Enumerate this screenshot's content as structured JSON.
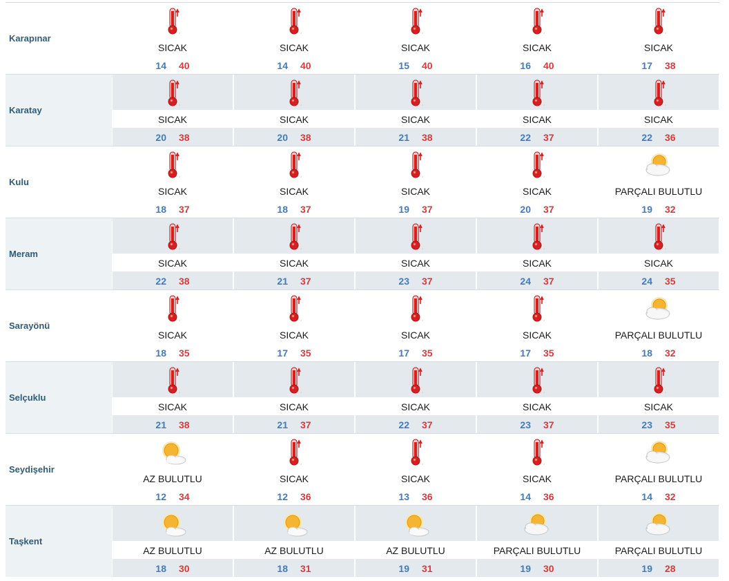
{
  "colors": {
    "low": "#3f7cc0",
    "high": "#d93b3b",
    "alt_band": "#e3e9ed",
    "name_text": "#2f5c7a"
  },
  "rows": [
    {
      "district": "Karapınar",
      "days": [
        {
          "icon": "thermometer-icon",
          "condition": "SICAK",
          "low": "14",
          "high": "40"
        },
        {
          "icon": "thermometer-icon",
          "condition": "SICAK",
          "low": "14",
          "high": "40"
        },
        {
          "icon": "thermometer-icon",
          "condition": "SICAK",
          "low": "15",
          "high": "40"
        },
        {
          "icon": "thermometer-icon",
          "condition": "SICAK",
          "low": "16",
          "high": "40"
        },
        {
          "icon": "thermometer-icon",
          "condition": "SICAK",
          "low": "17",
          "high": "38"
        }
      ]
    },
    {
      "district": "Karatay",
      "days": [
        {
          "icon": "thermometer-icon",
          "condition": "SICAK",
          "low": "20",
          "high": "38"
        },
        {
          "icon": "thermometer-icon",
          "condition": "SICAK",
          "low": "20",
          "high": "38"
        },
        {
          "icon": "thermometer-icon",
          "condition": "SICAK",
          "low": "21",
          "high": "38"
        },
        {
          "icon": "thermometer-icon",
          "condition": "SICAK",
          "low": "22",
          "high": "37"
        },
        {
          "icon": "thermometer-icon",
          "condition": "SICAK",
          "low": "22",
          "high": "36"
        }
      ]
    },
    {
      "district": "Kulu",
      "days": [
        {
          "icon": "thermometer-icon",
          "condition": "SICAK",
          "low": "18",
          "high": "37"
        },
        {
          "icon": "thermometer-icon",
          "condition": "SICAK",
          "low": "18",
          "high": "37"
        },
        {
          "icon": "thermometer-icon",
          "condition": "SICAK",
          "low": "19",
          "high": "37"
        },
        {
          "icon": "thermometer-icon",
          "condition": "SICAK",
          "low": "20",
          "high": "37"
        },
        {
          "icon": "partly-cloudy-icon",
          "condition": "PARÇALI BULUTLU",
          "low": "19",
          "high": "32"
        }
      ]
    },
    {
      "district": "Meram",
      "days": [
        {
          "icon": "thermometer-icon",
          "condition": "SICAK",
          "low": "22",
          "high": "38"
        },
        {
          "icon": "thermometer-icon",
          "condition": "SICAK",
          "low": "21",
          "high": "37"
        },
        {
          "icon": "thermometer-icon",
          "condition": "SICAK",
          "low": "23",
          "high": "37"
        },
        {
          "icon": "thermometer-icon",
          "condition": "SICAK",
          "low": "24",
          "high": "37"
        },
        {
          "icon": "thermometer-icon",
          "condition": "SICAK",
          "low": "24",
          "high": "35"
        }
      ]
    },
    {
      "district": "Sarayönü",
      "days": [
        {
          "icon": "thermometer-icon",
          "condition": "SICAK",
          "low": "18",
          "high": "35"
        },
        {
          "icon": "thermometer-icon",
          "condition": "SICAK",
          "low": "17",
          "high": "35"
        },
        {
          "icon": "thermometer-icon",
          "condition": "SICAK",
          "low": "17",
          "high": "35"
        },
        {
          "icon": "thermometer-icon",
          "condition": "SICAK",
          "low": "17",
          "high": "35"
        },
        {
          "icon": "partly-cloudy-icon",
          "condition": "PARÇALI BULUTLU",
          "low": "18",
          "high": "32"
        }
      ]
    },
    {
      "district": "Selçuklu",
      "days": [
        {
          "icon": "thermometer-icon",
          "condition": "SICAK",
          "low": "21",
          "high": "38"
        },
        {
          "icon": "thermometer-icon",
          "condition": "SICAK",
          "low": "21",
          "high": "37"
        },
        {
          "icon": "thermometer-icon",
          "condition": "SICAK",
          "low": "22",
          "high": "37"
        },
        {
          "icon": "thermometer-icon",
          "condition": "SICAK",
          "low": "23",
          "high": "37"
        },
        {
          "icon": "thermometer-icon",
          "condition": "SICAK",
          "low": "23",
          "high": "35"
        }
      ]
    },
    {
      "district": "Seydişehir",
      "days": [
        {
          "icon": "mostly-sunny-icon",
          "condition": "AZ BULUTLU",
          "low": "12",
          "high": "34"
        },
        {
          "icon": "thermometer-icon",
          "condition": "SICAK",
          "low": "12",
          "high": "36"
        },
        {
          "icon": "thermometer-icon",
          "condition": "SICAK",
          "low": "13",
          "high": "36"
        },
        {
          "icon": "thermometer-icon",
          "condition": "SICAK",
          "low": "14",
          "high": "36"
        },
        {
          "icon": "partly-cloudy-icon",
          "condition": "PARÇALI BULUTLU",
          "low": "14",
          "high": "32"
        }
      ]
    },
    {
      "district": "Taşkent",
      "days": [
        {
          "icon": "mostly-sunny-icon",
          "condition": "AZ BULUTLU",
          "low": "18",
          "high": "30"
        },
        {
          "icon": "mostly-sunny-icon",
          "condition": "AZ BULUTLU",
          "low": "18",
          "high": "31"
        },
        {
          "icon": "mostly-sunny-icon",
          "condition": "AZ BULUTLU",
          "low": "19",
          "high": "31"
        },
        {
          "icon": "partly-cloudy-icon",
          "condition": "PARÇALI BULUTLU",
          "low": "19",
          "high": "30"
        },
        {
          "icon": "partly-cloudy-icon",
          "condition": "PARÇALI BULUTLU",
          "low": "19",
          "high": "28"
        }
      ]
    }
  ]
}
